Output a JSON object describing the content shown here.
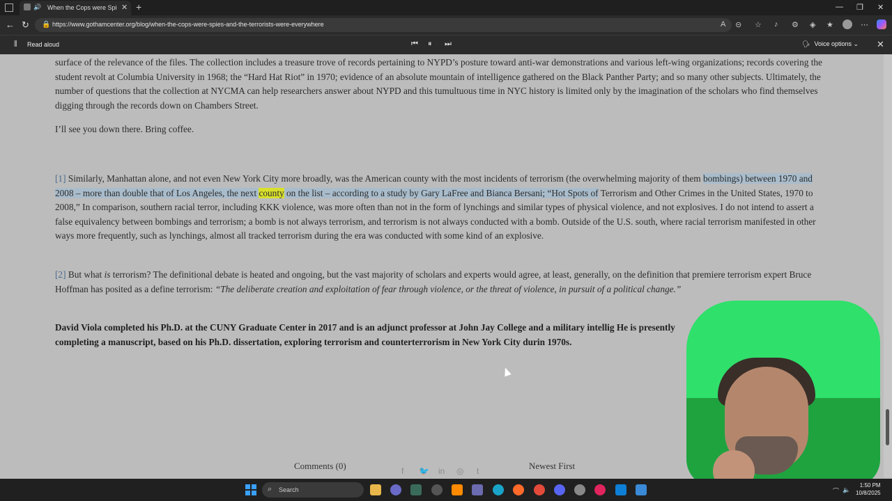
{
  "browser": {
    "tab_title": "When the Cops were Spies...",
    "url": "https://www.gothamcenter.org/blog/when-the-cops-were-spies-and-the-terrorists-were-everywhere"
  },
  "read_aloud": {
    "label": "Read aloud",
    "voice_options": "Voice options"
  },
  "article": {
    "p1": "surface of the relevance of the files. The collection includes a treasure trove of records pertaining to NYPD’s posture toward anti-war demonstrations and various left-wing organizations; records covering the student revolt at Columbia University in 1968; the “Hard Hat Riot” in 1970; evidence of an absolute mountain of intelligence gathered on the Black Panther Party; and so many other subjects.  Ultimately, the number of questions that the collection at NYCMA can help researchers answer about NYPD and this tumultuous time in NYC history is limited only by the imagination of the scholars who find themselves digging through the records down on Chambers Street.",
    "p2": "I’ll see you down there. Bring coffee.",
    "fn1_marker": "[1]",
    "fn1_a": " Similarly, Manhattan alone, and not even New York City more broadly, was the American county with the most incidents of terrorism (the overwhelming majority of them ",
    "fn1_hl1": "bombings) between 1970 and 2008 – more than double that of Los Angeles, the next ",
    "fn1_word": "county",
    "fn1_hl2": " on the list – according to a study by Gary LaFree and Bianca Bersani; “Hot Spots of",
    "fn1_b": " Terrorism and Other Crimes in the United States, 1970 to 2008,”  In comparison, southern racial terror, including KKK violence, was more often than not in the form of lynchings and similar types of physical violence, and not explosives. I do not intend to assert a false equivalency between bombings and terrorism; a bomb is not always terrorism, and terrorism is not always conducted with a bomb.  Outside of the U.S. south, where racial terrorism manifested in other ways more frequently, such as lynchings, almost all tracked terrorism during the era was conducted with some kind of an explosive.",
    "fn2_marker": "[2]",
    "fn2_a": " But what ",
    "fn2_is": "is",
    "fn2_b": " terrorism? The definitional debate is heated and ongoing, but the vast majority of scholars and experts would agree, at least, generally, on the definition that premiere terrorism expert Bruce Hoffman has posited as a define terrorism:  ",
    "fn2_quote": "“The deliberate creation and exploitation of fear through violence, or the threat of violence, in pursuit of a political change.”",
    "bio": "David Viola completed his Ph.D. at the CUNY Graduate Center in 2017 and is an adjunct professor at John Jay College and a military intellig He is presently completing a manuscript, based on his Ph.D. dissertation, exploring terrorism and counterterrorism in New York City durin 1970s."
  },
  "comments": {
    "count_label": "Comments (0)",
    "sort_label": "Newest First"
  },
  "taskbar": {
    "search_label": "Search",
    "time": "1:50 PM",
    "date": "10/8/2025"
  },
  "share_icons": [
    "facebook-icon",
    "twitter-icon",
    "linkedin-icon",
    "reddit-icon",
    "tumblr-icon"
  ]
}
